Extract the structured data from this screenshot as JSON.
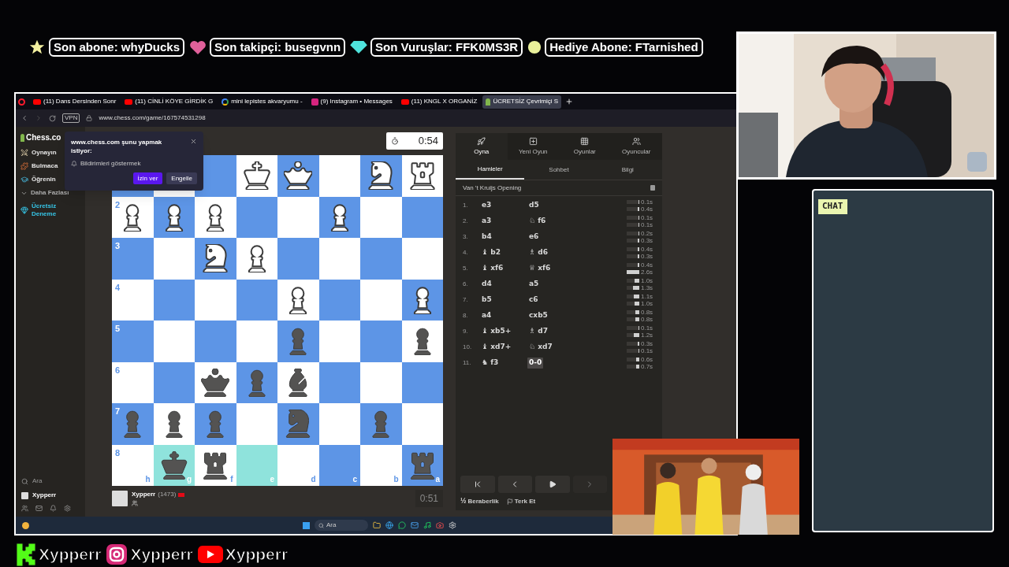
{
  "stream_alerts": [
    {
      "kind": "star",
      "label": "Son abone: whyDucks"
    },
    {
      "kind": "heart",
      "label": "Son takipçi: busegvnn"
    },
    {
      "kind": "diamond",
      "label": "Son Vuruşlar: FFK0MS3R"
    },
    {
      "kind": "coin",
      "label": "Hediye Abone: FTarnished"
    }
  ],
  "browser": {
    "tabs": [
      {
        "kind": "youtube",
        "title": "(11) Dans Dersinden Sonr",
        "selected": false
      },
      {
        "kind": "youtube",
        "title": "(11) CİNLİ KÖYE GİRDİK G",
        "selected": false
      },
      {
        "kind": "google",
        "title": "mini lepistes akvaryumu -",
        "selected": false
      },
      {
        "kind": "instagram",
        "title": "(9) Instagram • Messages",
        "selected": false
      },
      {
        "kind": "youtube",
        "title": "(11) KNGL X ORGANİZ",
        "selected": false
      },
      {
        "kind": "chess",
        "title": "ÜCRETSİZ Çevrimiçi S",
        "selected": true
      }
    ],
    "vpn": "VPN",
    "url": "www.chess.com/game/167574531298"
  },
  "sidebar": {
    "logo": "Chess.co",
    "items": [
      {
        "kind": "play",
        "label": "Oynayın"
      },
      {
        "kind": "puzzle",
        "label": "Bulmaca"
      },
      {
        "kind": "learn",
        "label": "Öğrenin"
      },
      {
        "kind": "more",
        "label": "Daha Fazlası"
      },
      {
        "kind": "trial",
        "label": "Ücretsiz Deneme"
      }
    ],
    "search": "Ara",
    "user": "Xypperr"
  },
  "permission_popup": {
    "title": "www.chess.com şunu yapmak istiyor:",
    "item": "Bildirimleri göstermek",
    "buttons": [
      {
        "label": "İzin ver",
        "primary": true
      },
      {
        "label": "Engelle",
        "primary": false
      }
    ]
  },
  "top_clock": "0:54",
  "board": {
    "files": [
      "h",
      "g",
      "f",
      "e",
      "d",
      "c",
      "b",
      "a"
    ],
    "ranks": [
      {
        "squares": [
          {
            "highlight": false
          },
          {
            "highlight": false
          },
          {
            "highlight": false
          },
          {
            "kind": "king",
            "white": true,
            "highlight": false
          },
          {
            "kind": "queen",
            "white": true,
            "highlight": false
          },
          {
            "highlight": false
          },
          {
            "kind": "knight",
            "white": true,
            "highlight": false
          },
          {
            "kind": "rook",
            "white": true,
            "highlight": false
          }
        ]
      },
      {
        "label": "2",
        "squares": [
          {
            "kind": "pawn",
            "white": true,
            "highlight": false
          },
          {
            "kind": "pawn",
            "white": true,
            "highlight": false
          },
          {
            "kind": "pawn",
            "white": true,
            "highlight": false
          },
          {
            "highlight": false
          },
          {
            "highlight": false
          },
          {
            "kind": "pawn",
            "white": true,
            "highlight": false
          },
          {
            "highlight": false
          },
          {
            "highlight": false
          }
        ]
      },
      {
        "label": "3",
        "squares": [
          {
            "highlight": false
          },
          {
            "highlight": false
          },
          {
            "kind": "knight",
            "white": true,
            "highlight": false
          },
          {
            "kind": "pawn",
            "white": true,
            "highlight": false
          },
          {
            "highlight": false
          },
          {
            "highlight": false
          },
          {
            "highlight": false
          },
          {
            "highlight": false
          }
        ]
      },
      {
        "label": "4",
        "squares": [
          {
            "highlight": false
          },
          {
            "highlight": false
          },
          {
            "highlight": false
          },
          {
            "highlight": false
          },
          {
            "kind": "pawn",
            "white": true,
            "highlight": false
          },
          {
            "highlight": false
          },
          {
            "highlight": false
          },
          {
            "kind": "pawn",
            "white": true,
            "highlight": false
          }
        ]
      },
      {
        "label": "5",
        "squares": [
          {
            "highlight": false
          },
          {
            "highlight": false
          },
          {
            "highlight": false
          },
          {
            "highlight": false
          },
          {
            "kind": "pawn",
            "white": false,
            "highlight": false
          },
          {
            "highlight": false
          },
          {
            "highlight": false
          },
          {
            "kind": "pawn",
            "white": false,
            "highlight": false
          }
        ]
      },
      {
        "label": "6",
        "squares": [
          {
            "highlight": false
          },
          {
            "highlight": false
          },
          {
            "kind": "queen",
            "white": false,
            "highlight": false
          },
          {
            "kind": "pawn",
            "white": false,
            "highlight": false
          },
          {
            "kind": "bishop",
            "white": false,
            "highlight": false
          },
          {
            "highlight": false
          },
          {
            "highlight": false
          },
          {
            "highlight": false
          }
        ]
      },
      {
        "label": "7",
        "squares": [
          {
            "kind": "pawn",
            "white": false,
            "highlight": false
          },
          {
            "kind": "pawn",
            "white": false,
            "highlight": false
          },
          {
            "kind": "pawn",
            "white": false,
            "highlight": false
          },
          {
            "highlight": false
          },
          {
            "kind": "knight",
            "white": false,
            "highlight": false
          },
          {
            "highlight": false
          },
          {
            "kind": "pawn",
            "white": false,
            "highlight": false
          },
          {
            "highlight": false
          }
        ]
      },
      {
        "label": "8",
        "squares": [
          {
            "highlight": false
          },
          {
            "kind": "king",
            "white": false,
            "highlight": true
          },
          {
            "kind": "rook",
            "white": false,
            "highlight": false
          },
          {
            "highlight": true
          },
          {
            "highlight": false
          },
          {
            "highlight": false
          },
          {
            "highlight": false
          },
          {
            "kind": "rook",
            "white": false,
            "highlight": false
          }
        ]
      }
    ]
  },
  "player": {
    "name": "Xypperr",
    "rating": "(1473)",
    "clock": "0:51"
  },
  "panel": {
    "nav": [
      {
        "kind": "play",
        "label": "Oyna",
        "selected": true
      },
      {
        "kind": "new",
        "label": "Yeni Oyun",
        "selected": false
      },
      {
        "kind": "games",
        "label": "Oyunlar",
        "selected": false
      },
      {
        "kind": "players",
        "label": "Oyuncular",
        "selected": false
      }
    ],
    "tabs": [
      {
        "label": "Hamleler",
        "selected": true
      },
      {
        "label": "Sohbet",
        "selected": false
      },
      {
        "label": "Bilgi",
        "selected": false
      }
    ],
    "opening": "Van 't Kruijs Opening",
    "moves": [
      {
        "number": "1.",
        "white": {
          "text": "e3",
          "time": "0.1s",
          "level": 0.04,
          "selected": false
        },
        "black": {
          "text": "d5",
          "time": "0.4s",
          "level": 0.15,
          "selected": false
        }
      },
      {
        "number": "2.",
        "white": {
          "text": "a3",
          "time": "0.1s",
          "level": 0.04,
          "selected": false
        },
        "black": {
          "text": "♘ f6",
          "time": "0.1s",
          "level": 0.04,
          "selected": false
        }
      },
      {
        "number": "3.",
        "white": {
          "text": "b4",
          "time": "0.2s",
          "level": 0.08,
          "selected": false
        },
        "black": {
          "text": "e6",
          "time": "0.3s",
          "level": 0.12,
          "selected": false
        }
      },
      {
        "number": "4.",
        "white": {
          "text": "♝ b2",
          "time": "0.4s",
          "level": 0.15,
          "selected": false
        },
        "black": {
          "text": "♗ d6",
          "time": "0.3s",
          "level": 0.12,
          "selected": false
        }
      },
      {
        "number": "5.",
        "white": {
          "text": "♝ xf6",
          "time": "0.4s",
          "level": 0.15,
          "selected": false
        },
        "black": {
          "text": "♕ xf6",
          "time": "2.6s",
          "level": 1,
          "selected": false
        }
      },
      {
        "number": "6.",
        "white": {
          "text": "d4",
          "time": "1.0s",
          "level": 0.38,
          "selected": false
        },
        "black": {
          "text": "a5",
          "time": "1.3s",
          "level": 0.5,
          "selected": false
        }
      },
      {
        "number": "7.",
        "white": {
          "text": "b5",
          "time": "1.1s",
          "level": 0.42,
          "selected": false
        },
        "black": {
          "text": "c6",
          "time": "1.0s",
          "level": 0.38,
          "selected": false
        }
      },
      {
        "number": "8.",
        "white": {
          "text": "a4",
          "time": "0.8s",
          "level": 0.31,
          "selected": false
        },
        "black": {
          "text": "cxb5",
          "time": "0.8s",
          "level": 0.31,
          "selected": false
        }
      },
      {
        "number": "9.",
        "white": {
          "text": "♝ xb5+",
          "time": "0.1s",
          "level": 0.04,
          "selected": false
        },
        "black": {
          "text": "♗ d7",
          "time": "1.2s",
          "level": 0.46,
          "selected": false
        }
      },
      {
        "number": "10.",
        "white": {
          "text": "♝ xd7+",
          "time": "0.3s",
          "level": 0.12,
          "selected": false
        },
        "black": {
          "text": "♘ xd7",
          "time": "0.1s",
          "level": 0.04,
          "selected": false
        }
      },
      {
        "number": "11.",
        "white": {
          "text": "♞ f3",
          "time": "0.6s",
          "level": 0.23,
          "selected": false
        },
        "black": {
          "text": "0-0",
          "time": "0.7s",
          "level": 0.27,
          "selected": true
        }
      }
    ],
    "draw": {
      "icon": "½",
      "label": "Beraberlik"
    },
    "resign": "Terk Et"
  },
  "taskbar": {
    "search": "Ara"
  },
  "chat": {
    "title": "CHAT"
  },
  "socials": [
    {
      "kind": "kick",
      "handle": "Xypperr"
    },
    {
      "kind": "instagram",
      "handle": "Xypperr"
    },
    {
      "kind": "youtube",
      "handle": "Xypperr"
    }
  ]
}
